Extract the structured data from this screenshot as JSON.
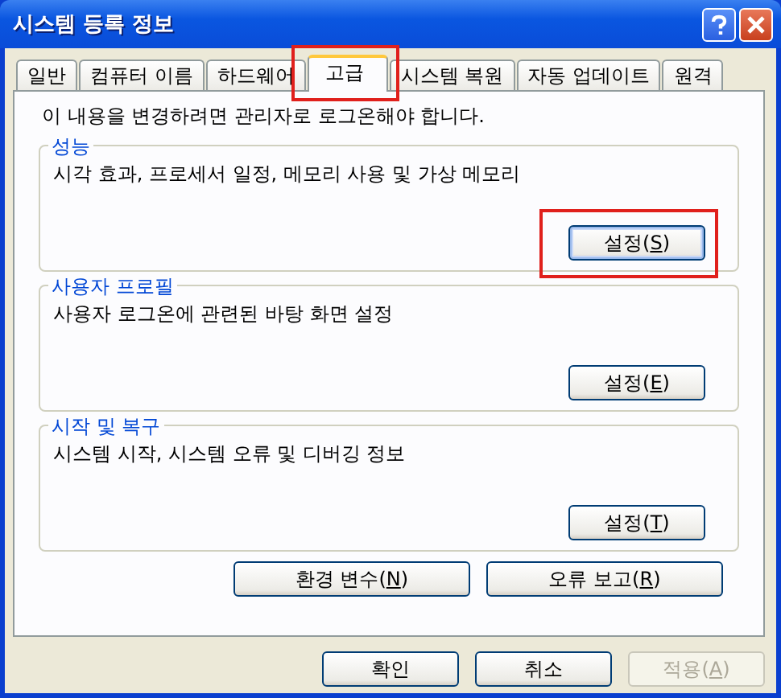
{
  "window": {
    "title": "시스템 등록 정보"
  },
  "tabs": [
    {
      "label": "일반",
      "selected": false
    },
    {
      "label": "컴퓨터 이름",
      "selected": false
    },
    {
      "label": "하드웨어",
      "selected": false
    },
    {
      "label": "고급",
      "selected": true,
      "highlighted": true
    },
    {
      "label": "시스템 복원",
      "selected": false
    },
    {
      "label": "자동 업데이트",
      "selected": false
    },
    {
      "label": "원격",
      "selected": false
    }
  ],
  "notice": "이 내용을 변경하려면 관리자로 로그온해야 합니다.",
  "groups": [
    {
      "title": "성능",
      "description": "시각 효과, 프로세서 일정, 메모리 사용 및 가상 메모리",
      "button": {
        "label": "설정(S)",
        "focused": true,
        "highlighted": true
      }
    },
    {
      "title": "사용자 프로필",
      "description": "사용자 로그온에 관련된 바탕 화면 설정",
      "button": {
        "label": "설정(E)",
        "focused": false,
        "highlighted": false
      }
    },
    {
      "title": "시작 및 복구",
      "description": "시스템 시작, 시스템 오류 및 디버깅 정보",
      "button": {
        "label": "설정(T)",
        "focused": false,
        "highlighted": false
      }
    }
  ],
  "panel_buttons": [
    {
      "label": "환경 변수(N)"
    },
    {
      "label": "오류 보고(R)"
    }
  ],
  "dialog_buttons": [
    {
      "label": "확인",
      "disabled": false
    },
    {
      "label": "취소",
      "disabled": false
    },
    {
      "label": "적용(A)",
      "disabled": true
    }
  ]
}
